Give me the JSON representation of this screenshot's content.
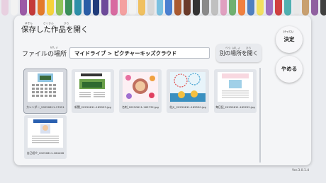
{
  "crayon_colors": [
    "#e8d0e0",
    "#f2f2f2",
    "#9b5aa6",
    "#c43a3a",
    "#e37a2b",
    "#f6d23c",
    "#8fc35a",
    "#3a8f5a",
    "#2c8fa8",
    "#2a5da6",
    "#1f3b7a",
    "#6d4a9a",
    "#d86aa0",
    "#f4a0a0",
    "#f2f2f2",
    "#f0c060",
    "#d8d8d8",
    "#7ac0e0",
    "#4a7fd0",
    "#aa5a30",
    "#6a3a2a",
    "#333333",
    "#8a8a8a",
    "#c0c0c0",
    "#e0a0c0",
    "#70b070",
    "#f08040",
    "#5080c0",
    "#f2e060",
    "#a070c0",
    "#d04040",
    "#50b0b0",
    "#e8e8e8",
    "#c8a070",
    "#9060a0",
    "#404040"
  ],
  "dialog": {
    "title": "保存した作品を開く",
    "title_ruby": [
      "ほぞん",
      "さくひん",
      "ひら"
    ],
    "location_label": "ファイルの場所",
    "location_ruby": "ばしょ",
    "path": "マイドライブ > ピクチャーキッズクラウド",
    "other_location": "別の場所を開く",
    "other_location_ruby": [
      "べつ",
      "ばしょ",
      "ひら"
    ],
    "decide": "決定",
    "decide_ruby": "けってい",
    "cancel": "やめる",
    "version": "Ver.3.0.1.4"
  },
  "files": [
    {
      "name": "カレンダー_20250611-17051",
      "kind": "calendar",
      "selected": true
    },
    {
      "name": "新聞_20250611-165953.jpg",
      "kind": "newspaper",
      "selected": false
    },
    {
      "name": "名刺_20250611-165732.jpg",
      "kind": "card",
      "selected": false
    },
    {
      "name": "花火_20250611-165550.jpg",
      "kind": "fireworks",
      "selected": false
    },
    {
      "name": "毎日記_20250611-165252.jpg",
      "kind": "diary",
      "selected": false
    },
    {
      "name": "自己紹介_20250611-164428",
      "kind": "profile",
      "selected": false
    }
  ]
}
